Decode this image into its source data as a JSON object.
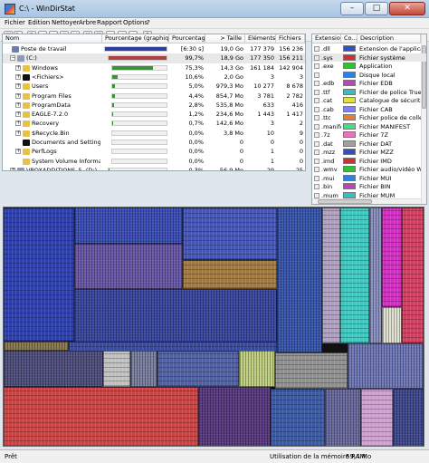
{
  "window": {
    "title": "C:\\ - WinDirStat",
    "minimize": "–",
    "maximize": "□",
    "close": "✕"
  },
  "menu": [
    "Fichier",
    "Edition",
    "Nettoyer",
    "Arbre",
    "Rapport",
    "Options",
    "?"
  ],
  "toolbar": [
    "open-icon",
    "refresh-icon",
    "copy-icon",
    "explorer-icon",
    "cmd-icon",
    "recycle-icon",
    "delete-icon",
    "delete-permanent-icon",
    "new-icon",
    "properties-icon",
    "zoom-in-icon",
    "zoom-out-icon",
    "help-icon"
  ],
  "tree": {
    "columns": [
      "Nom",
      "Pourcentage (graphique)",
      "Pourcentage",
      "> Taille",
      "Eléments",
      "Fichiers"
    ],
    "rows": [
      {
        "name": "Poste de travail",
        "pct_text": "[6:30 s]",
        "size": "19,0 Go",
        "elements": "177 379",
        "files": "156 236",
        "expander": "",
        "indent": 0,
        "icon": "#6a7fae",
        "bar": 1.0,
        "bar_color": "#2e3f9f",
        "selected": false
      },
      {
        "name": "(C:)",
        "pct_text": "99,7%",
        "size": "18,9 Go",
        "elements": "177 350",
        "files": "156 211",
        "expander": "−",
        "indent": 1,
        "icon": "#8a9bbd",
        "bar": 0.997,
        "bar_color": "#b04040",
        "selected": true
      },
      {
        "name": "Windows",
        "pct_text": "75,3%",
        "size": "14,3 Go",
        "elements": "161 184",
        "files": "142 904",
        "expander": "+",
        "indent": 2,
        "icon": "#e6c24a",
        "bar": 0.753,
        "bar_color": "#3d8f3d",
        "selected": false
      },
      {
        "name": "<Fichiers>",
        "pct_text": "10,6%",
        "size": "2,0 Go",
        "elements": "3",
        "files": "3",
        "expander": "+",
        "indent": 2,
        "icon": "#111111",
        "bar": 0.106,
        "bar_color": "#3d8f3d",
        "selected": false
      },
      {
        "name": "Users",
        "pct_text": "5,0%",
        "size": "979,3 Mo",
        "elements": "10 277",
        "files": "8 678",
        "expander": "+",
        "indent": 2,
        "icon": "#e6c24a",
        "bar": 0.05,
        "bar_color": "#3d8f3d",
        "selected": false
      },
      {
        "name": "Program Files",
        "pct_text": "4,4%",
        "size": "854,7 Mo",
        "elements": "3 781",
        "files": "2 782",
        "expander": "+",
        "indent": 2,
        "icon": "#e6c24a",
        "bar": 0.044,
        "bar_color": "#3d8f3d",
        "selected": false
      },
      {
        "name": "ProgramData",
        "pct_text": "2,8%",
        "size": "535,8 Mo",
        "elements": "633",
        "files": "416",
        "expander": "+",
        "indent": 2,
        "icon": "#e6c24a",
        "bar": 0.028,
        "bar_color": "#3d8f3d",
        "selected": false
      },
      {
        "name": "EAGLE-7.2.0",
        "pct_text": "1,2%",
        "size": "234,6 Mo",
        "elements": "1 443",
        "files": "1 417",
        "expander": "+",
        "indent": 2,
        "icon": "#e6c24a",
        "bar": 0.012,
        "bar_color": "#3d8f3d",
        "selected": false
      },
      {
        "name": "Recovery",
        "pct_text": "0,7%",
        "size": "142,6 Mo",
        "elements": "3",
        "files": "2",
        "expander": "+",
        "indent": 2,
        "icon": "#e6c24a",
        "bar": 0.007,
        "bar_color": "#3d8f3d",
        "selected": false
      },
      {
        "name": "$Recycle.Bin",
        "pct_text": "0,0%",
        "size": "3,8 Mo",
        "elements": "10",
        "files": "9",
        "expander": "+",
        "indent": 2,
        "icon": "#e6c24a",
        "bar": 0.0,
        "bar_color": "#3d8f3d",
        "selected": false
      },
      {
        "name": "Documents and Settings",
        "pct_text": "0,0%",
        "size": "0",
        "elements": "0",
        "files": "0",
        "expander": "",
        "indent": 2,
        "icon": "#111111",
        "bar": 0.0,
        "bar_color": "#3d8f3d",
        "selected": false
      },
      {
        "name": "PerfLogs",
        "pct_text": "0,0%",
        "size": "0",
        "elements": "1",
        "files": "0",
        "expander": "+",
        "indent": 2,
        "icon": "#e6c24a",
        "bar": 0.0,
        "bar_color": "#3d8f3d",
        "selected": false
      },
      {
        "name": "System Volume Informati...",
        "pct_text": "0,0%",
        "size": "0",
        "elements": "1",
        "files": "0",
        "expander": "",
        "indent": 2,
        "icon": "#e6c24a",
        "bar": 0.0,
        "bar_color": "#3d8f3d",
        "selected": false
      },
      {
        "name": "VBOXADDITIONS_5. (D:)",
        "pct_text": "0,3%",
        "size": "56,9 Mo",
        "elements": "29",
        "files": "25",
        "expander": "+",
        "indent": 1,
        "icon": "#8a9bbd",
        "bar": 0.003,
        "bar_color": "#3d8f3d",
        "selected": false
      }
    ]
  },
  "extensions": {
    "columns": [
      "Extensio...",
      "Co...",
      "Description"
    ],
    "rows": [
      {
        "ext": ".dll",
        "color": "#3050c8",
        "desc": "Extension de l'application"
      },
      {
        "ext": ".sys",
        "color": "#d03030",
        "desc": "Fichier système"
      },
      {
        "ext": ".exe",
        "color": "#30c030",
        "desc": "Application"
      },
      {
        "ext": "",
        "color": "#3080e0",
        "desc": "Disque local"
      },
      {
        "ext": ".edb",
        "color": "#c040c0",
        "desc": "Fichier EDB"
      },
      {
        "ext": ".ttf",
        "color": "#30c0c0",
        "desc": "Fichier de police TrueTyp"
      },
      {
        "ext": ".cat",
        "color": "#e0e040",
        "desc": "Catalogue de sécurité"
      },
      {
        "ext": ".cab",
        "color": "#8080f0",
        "desc": "Fichier CAB"
      },
      {
        "ext": ".ttc",
        "color": "#e08030",
        "desc": "Fichier police de collecti"
      },
      {
        "ext": ".manifest",
        "color": "#40e080",
        "desc": "Fichier MANIFEST"
      },
      {
        "ext": ".7z",
        "color": "#f070c0",
        "desc": "Fichier 7Z"
      },
      {
        "ext": ".dat",
        "color": "#a0a0a0",
        "desc": "Fichier DAT"
      },
      {
        "ext": ".mzz",
        "color": "#3050c8",
        "desc": "Fichier MZZ"
      },
      {
        "ext": ".imd",
        "color": "#d03030",
        "desc": "Fichier IMD"
      },
      {
        "ext": ".wmv",
        "color": "#30c030",
        "desc": "Fichier audio/vidéo Winc"
      },
      {
        "ext": ".mui",
        "color": "#3080e0",
        "desc": "Fichier MUI"
      },
      {
        "ext": ".bin",
        "color": "#c040c0",
        "desc": "Fichier BIN"
      },
      {
        "ext": ".mum",
        "color": "#30c0c0",
        "desc": "Fichier MUM"
      }
    ]
  },
  "status": {
    "left": "Prêt",
    "memory_label": "Utilisation de la mémoire RAM:",
    "memory_value": "59,4 Mo"
  }
}
